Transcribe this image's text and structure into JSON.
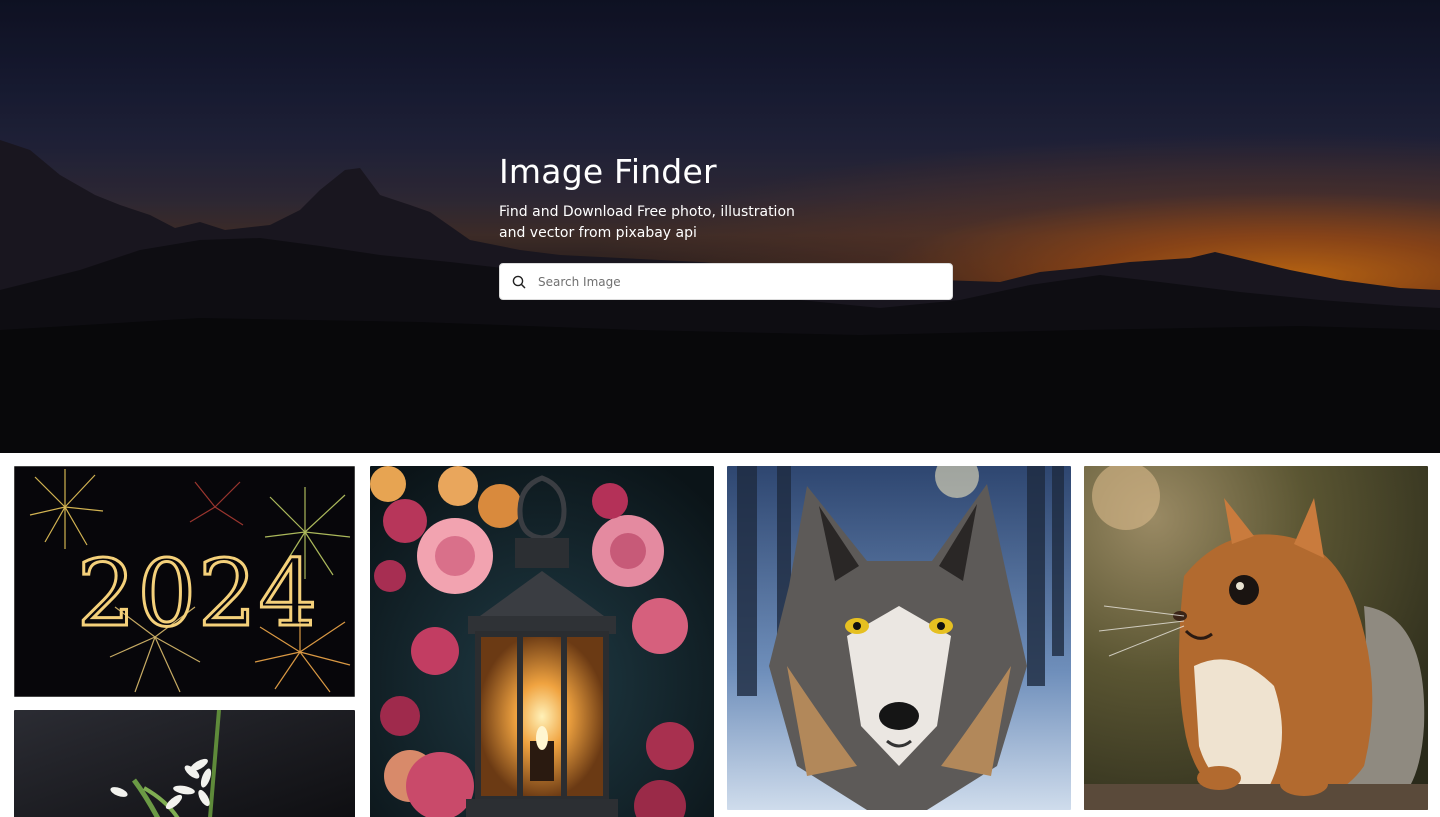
{
  "hero": {
    "title": "Image Finder",
    "subtitle": "Find and Download Free photo, illustration and vector from pixabay api",
    "background_scene": "mountain-sunset",
    "accent_colors": {
      "sky_top": "#12152a",
      "sunset": "#e87e16",
      "mountains": "#0b0b0e"
    }
  },
  "search": {
    "placeholder": "Search Image",
    "value": "",
    "icon": "search-icon"
  },
  "gallery": {
    "images": [
      {
        "id": "new-year-2024",
        "subject": "fireworks",
        "text": "2024"
      },
      {
        "id": "white-flowers",
        "subject": "flowers"
      },
      {
        "id": "lantern-roses",
        "subject": "lantern"
      },
      {
        "id": "wolf-portrait",
        "subject": "wolf"
      },
      {
        "id": "squirrel",
        "subject": "squirrel"
      }
    ]
  }
}
